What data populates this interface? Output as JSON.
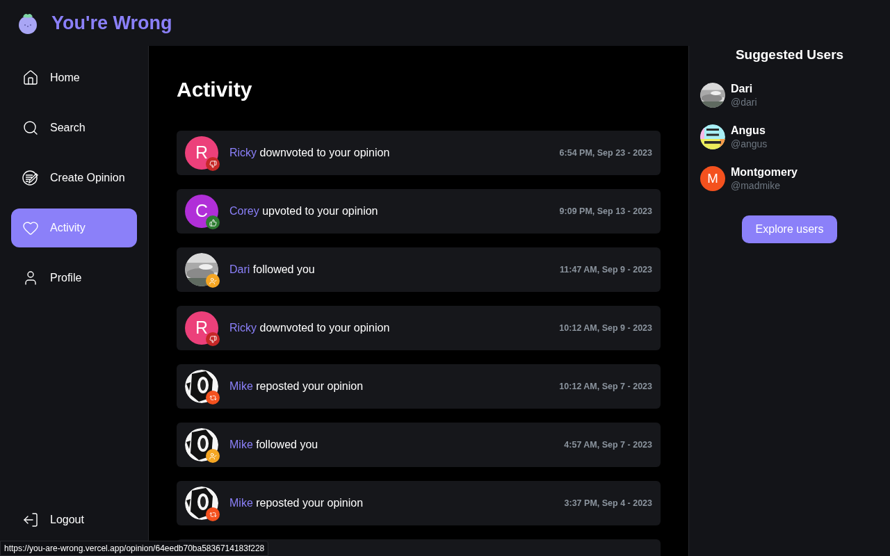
{
  "app": {
    "title": "You're Wrong"
  },
  "sidebar": {
    "items": [
      {
        "label": "Home",
        "selected": false
      },
      {
        "label": "Search",
        "selected": false
      },
      {
        "label": "Create Opinion",
        "selected": false
      },
      {
        "label": "Activity",
        "selected": true
      },
      {
        "label": "Profile",
        "selected": false
      }
    ],
    "logout": {
      "label": "Logout"
    }
  },
  "main": {
    "title": "Activity",
    "activities": [
      {
        "user": "Ricky",
        "text": "downvoted to your opinion",
        "time": "6:54 PM, Sep 23 - 2023",
        "kind": "downvote",
        "avatar": {
          "kind": "letter",
          "letter": "R",
          "color": "#ec407a"
        }
      },
      {
        "user": "Corey",
        "text": "upvoted to your opinion",
        "time": "9:09 PM, Sep 13 - 2023",
        "kind": "upvote",
        "avatar": {
          "kind": "letter",
          "letter": "C",
          "color": "#b02fd8"
        }
      },
      {
        "user": "Dari",
        "text": "followed you",
        "time": "11:47 AM, Sep 9 - 2023",
        "kind": "follow"
      },
      {
        "user": "Ricky",
        "text": "downvoted to your opinion",
        "time": "10:12 AM, Sep 9 - 2023",
        "kind": "downvote",
        "avatar": {
          "kind": "letter",
          "letter": "R",
          "color": "#ec407a"
        }
      },
      {
        "user": "Mike",
        "text": "reposted your opinion",
        "time": "10:12 AM, Sep 7 - 2023",
        "kind": "repost"
      },
      {
        "user": "Mike",
        "text": "followed you",
        "time": "4:57 AM, Sep 7 - 2023",
        "kind": "follow"
      },
      {
        "user": "Mike",
        "text": "reposted your opinion",
        "time": "3:37 PM, Sep 4 - 2023",
        "kind": "repost"
      }
    ]
  },
  "suggested": {
    "title": "Suggested Users",
    "users": [
      {
        "name": "Dari",
        "handle": "@dari"
      },
      {
        "name": "Angus",
        "handle": "@angus"
      },
      {
        "name": "Montgomery",
        "handle": "@madmike",
        "avatar": {
          "kind": "letter",
          "letter": "M",
          "color": "#f4511e"
        }
      }
    ],
    "button": "Explore users"
  },
  "status_bar": {
    "url": "https://you-are-wrong.vercel.app/opinion/64eedb70ba5836714183f228"
  }
}
